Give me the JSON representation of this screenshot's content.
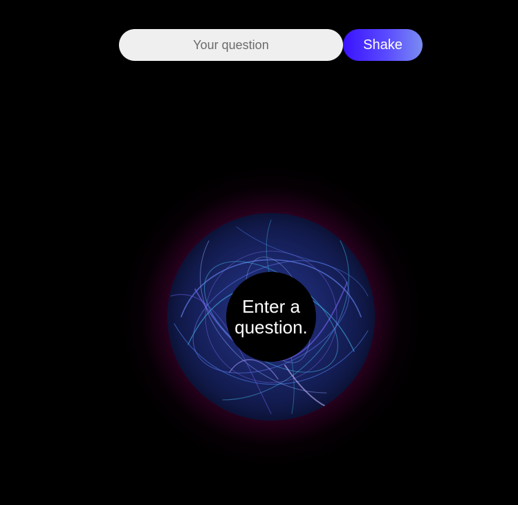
{
  "search": {
    "placeholder": "Your question",
    "value": ""
  },
  "actions": {
    "shake_label": "Shake"
  },
  "ball": {
    "answer": "Enter a question."
  },
  "colors": {
    "background": "#000000",
    "button_gradient_start": "#3a12ff",
    "button_gradient_end": "#7a8cf0",
    "glow": "#96006e",
    "ball_swirl": "#4a7ae8"
  }
}
